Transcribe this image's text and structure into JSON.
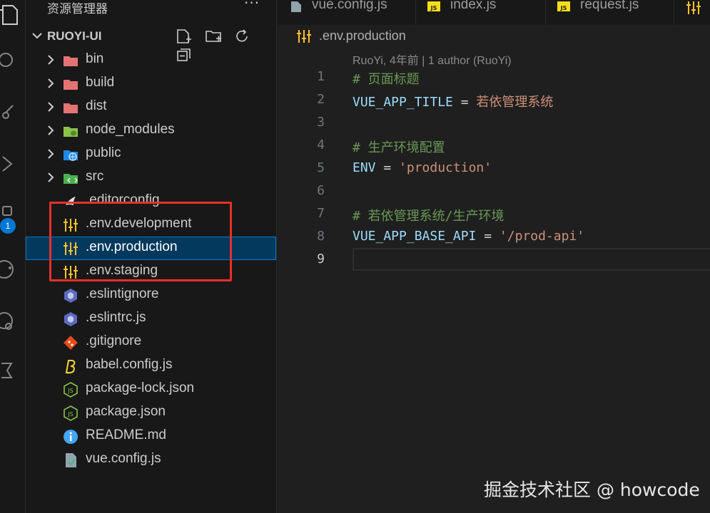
{
  "activity_bar": {
    "icons": [
      "explorer-icon",
      "search-icon",
      "source-control-icon",
      "run-debug-icon",
      "extensions-icon",
      "remote-icon",
      "timeline-icon",
      "testing-icon"
    ],
    "badge_count": "1"
  },
  "sidebar": {
    "title": "资源管理器",
    "more_label": "···",
    "project_name": "RUOYI-UI",
    "actions": [
      "new-file-icon",
      "new-folder-icon",
      "refresh-icon",
      "collapse-all-icon"
    ],
    "items": [
      {
        "label": "bin",
        "type": "folder"
      },
      {
        "label": "build",
        "type": "folder"
      },
      {
        "label": "dist",
        "type": "folder"
      },
      {
        "label": "node_modules",
        "type": "folder"
      },
      {
        "label": "public",
        "type": "folder"
      },
      {
        "label": "src",
        "type": "folder"
      },
      {
        "label": ".editorconfig",
        "type": "file"
      },
      {
        "label": ".env.development",
        "type": "file"
      },
      {
        "label": ".env.production",
        "type": "file"
      },
      {
        "label": ".env.staging",
        "type": "file"
      },
      {
        "label": ".eslintignore",
        "type": "file"
      },
      {
        "label": ".eslintrc.js",
        "type": "file"
      },
      {
        "label": ".gitignore",
        "type": "file"
      },
      {
        "label": "babel.config.js",
        "type": "file"
      },
      {
        "label": "package-lock.json",
        "type": "file"
      },
      {
        "label": "package.json",
        "type": "file"
      },
      {
        "label": "README.md",
        "type": "file"
      },
      {
        "label": "vue.config.js",
        "type": "file"
      }
    ],
    "selected_item": ".env.production"
  },
  "tabs": [
    {
      "label": "vue.config.js"
    },
    {
      "label": "index.js"
    },
    {
      "label": "request.js"
    }
  ],
  "breadcrumb": {
    "label": ".env.production"
  },
  "blame": {
    "text": "RuoYi, 4年前 | 1 author (RuoYi)"
  },
  "code": {
    "line_numbers": [
      "1",
      "2",
      "3",
      "4",
      "5",
      "6",
      "7",
      "8",
      "9"
    ],
    "current_line": "9",
    "lines": {
      "l1": "# 页面标题",
      "l2_key": "VUE_APP_TITLE",
      "l2_op": " = ",
      "l2_val": "若依管理系统",
      "l4": "# 生产环境配置",
      "l5_key": "ENV",
      "l5_op": " = ",
      "l5_val": "'production'",
      "l7": "# 若依管理系统/生产环境",
      "l8_key": "VUE_APP_BASE_API",
      "l8_op": " = ",
      "l8_val": "'/prod-api'"
    }
  },
  "colors": {
    "highlight_box": "#e8302a",
    "selection": "#04395e",
    "accent": "#0078d4",
    "comment": "#6a9955",
    "string": "#ce9178",
    "variable": "#9cdcfe"
  },
  "watermark": "掘金技术社区 @ howcode"
}
